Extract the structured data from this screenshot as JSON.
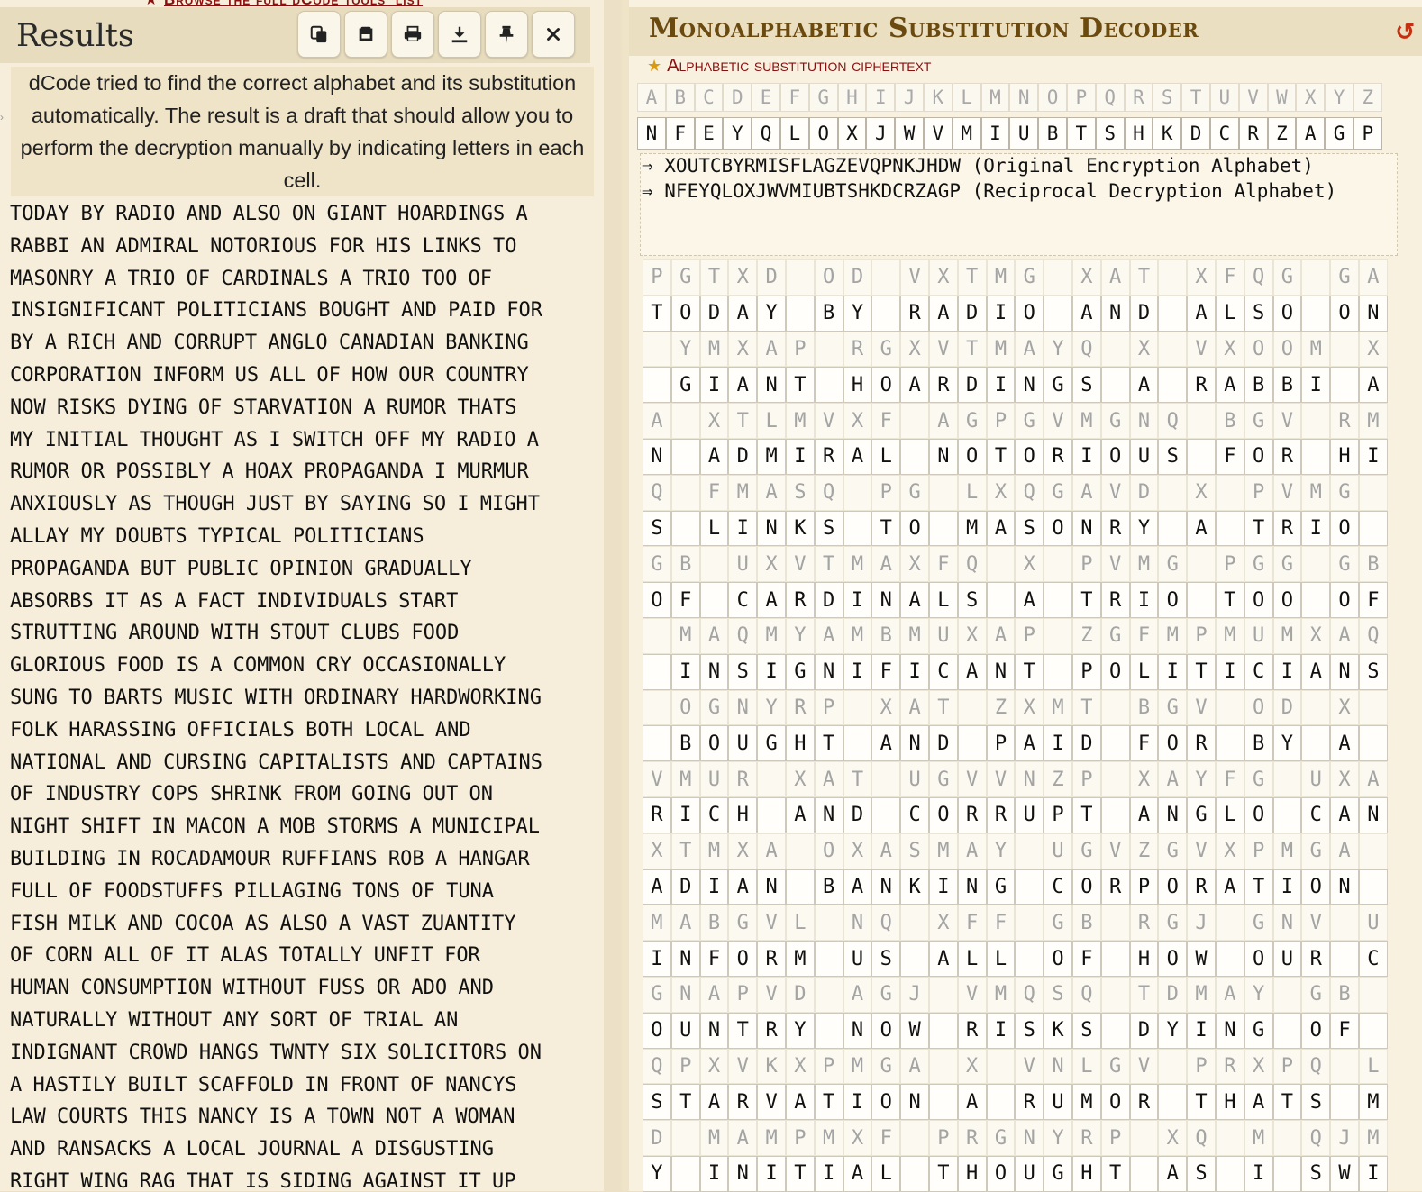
{
  "left": {
    "top_link_text": "Browse the full dCode tools' list",
    "results_title": "Results",
    "toolbar_icons": [
      "copy-icon",
      "save-icon",
      "print-icon",
      "download-icon",
      "pin-icon",
      "close-icon"
    ],
    "info_text": "dCode tried to find the correct alphabet and its substitution automatically. The result is a draft that should allow you to perform the decryption manually by indicating letters in each cell.",
    "plaintext_lines": [
      "TODAY BY RADIO AND ALSO ON GIANT HOARDINGS A",
      "RABBI AN ADMIRAL NOTORIOUS FOR HIS LINKS TO",
      "MASONRY A TRIO OF CARDINALS A TRIO TOO OF",
      "INSIGNIFICANT POLITICIANS BOUGHT AND PAID FOR",
      "BY A RICH AND CORRUPT ANGLO CANADIAN BANKING",
      "CORPORATION INFORM US ALL OF HOW OUR COUNTRY",
      "NOW RISKS DYING OF STARVATION A RUMOR THATS",
      "MY INITIAL THOUGHT AS I SWITCH OFF MY RADIO A",
      "RUMOR OR POSSIBLY A HOAX PROPAGANDA I MURMUR",
      "ANXIOUSLY AS THOUGH JUST BY SAYING SO I MIGHT",
      "ALLAY MY DOUBTS TYPICAL POLITICIANS",
      "PROPAGANDA BUT PUBLIC OPINION GRADUALLY",
      "ABSORBS IT AS A FACT INDIVIDUALS START",
      "STRUTTING AROUND WITH STOUT CLUBS FOOD",
      "GLORIOUS FOOD IS A COMMON CRY OCCASIONALLY",
      "SUNG TO BARTS MUSIC WITH ORDINARY HARDWORKING",
      "FOLK HARASSING OFFICIALS BOTH LOCAL AND",
      "NATIONAL AND CURSING CAPITALISTS AND CAPTAINS",
      "OF INDUSTRY COPS SHRINK FROM GOING OUT ON",
      "NIGHT SHIFT IN MACON A MOB STORMS A MUNICIPAL",
      "BUILDING IN ROCADAMOUR RUFFIANS ROB A HANGAR",
      "FULL OF FOODSTUFFS PILLAGING TONS OF TUNA",
      "FISH MILK AND COCOA AS ALSO A VAST ZUANTITY",
      "OF CORN ALL OF IT ALAS TOTALLY UNFIT FOR",
      "HUMAN CONSUMPTION WITHOUT FUSS OR ADO AND",
      "NATURALLY WITHOUT ANY SORT OF TRIAL AN",
      "INDIGNANT CROWD HANGS TWNTY SIX SOLICITORS ON",
      "A HASTILY BUILT SCAFFOLD IN FRONT OF NANCYS",
      "LAW COURTS THIS NANCY IS A TOWN NOT A WOMAN",
      "AND RANSACKS A LOCAL JOURNAL A DISGUSTING",
      "RIGHT WING RAG THAT IS SIDING AGAINST IT UP"
    ]
  },
  "right": {
    "title": "Monoalphabetic Substitution Decoder",
    "refresh_icon": "refresh-icon",
    "ciphertext_label": "Alphabetic substitution ciphertext",
    "alphabet_plain": "ABCDEFGHIJKLMNOPQRSTUVWXYZ",
    "alphabet_subst": "NFEYQLOXJWVMIUBTSHKDCRZAGP",
    "original_alphabet_line": "⇒ XOUTCBYRMISFLAGZEVQPNKJHDW (Original Encryption Alphabet)",
    "reciprocal_alphabet_line": "⇒ NFEYQLOXJWVMIUBTSHKDCRZAGP (Reciprocal Decryption Alphabet)",
    "grid_rows": [
      {
        "cipher": "PGTXD OD VXTMG XAT XFQG GA",
        "plain": "TODAY BY RADIO AND ALSO ON"
      },
      {
        "cipher": " YMXAP RGXVTMAYQ X VXOOM X",
        "plain": " GIANT HOARDINGS A RABBI A"
      },
      {
        "cipher": "A XTLMVXF AGPGVMGNQ BGV RM",
        "plain": "N ADMIRAL NOTORIOUS FOR HI"
      },
      {
        "cipher": "Q FMASQ PG LXQGAVD X PVMG ",
        "plain": "S LINKS TO MASONRY A TRIO "
      },
      {
        "cipher": "GB UXVTMAXFQ X PVMG PGG GB",
        "plain": "OF CARDINALS A TRIO TOO OF"
      },
      {
        "cipher": " MAQMYAMBMUXAP ZGFMPMUMXAQ",
        "plain": " INSIGNIFICANT POLITICIANS"
      },
      {
        "cipher": " OGNYRP XAT ZXMT BGV OD X ",
        "plain": " BOUGHT AND PAID FOR BY A "
      },
      {
        "cipher": "VMUR XAT UGVVNZP XAYFG UXA",
        "plain": "RICH AND CORRUPT ANGLO CAN"
      },
      {
        "cipher": "XTMXA OXASMAY UGVZGVXPMGA ",
        "plain": "ADIAN BANKING CORPORATION "
      },
      {
        "cipher": "MABGVL NQ XFF GB RGJ GNV U",
        "plain": "INFORM US ALL OF HOW OUR C"
      },
      {
        "cipher": "GNAPVD AGJ VMQSQ TDMAY GB ",
        "plain": "OUNTRY NOW RISKS DYING OF "
      },
      {
        "cipher": "QPXVKXPMGA X VNLGV PRXPQ L",
        "plain": "STARVATION A RUMOR THATS M"
      },
      {
        "cipher": "D MAMPMXF PRGNYRP XQ M QJM",
        "plain": "Y INITIAL THOUGHT AS I SWI"
      }
    ]
  }
}
